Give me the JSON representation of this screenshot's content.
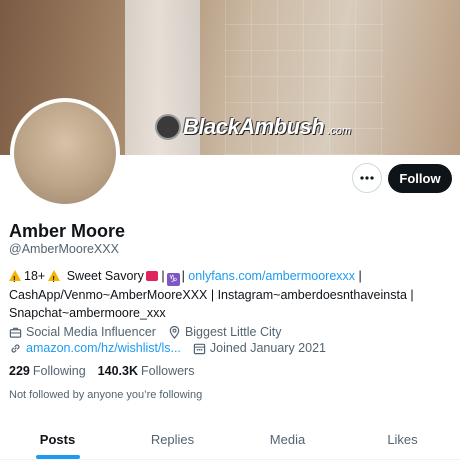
{
  "banner": {
    "logo_text": "BlackAmbush",
    "logo_tld": ".com"
  },
  "actions": {
    "follow_label": "Follow"
  },
  "profile": {
    "name": "Amber Moore",
    "handle": "@AmberMooreXXX",
    "bio": {
      "line1_a": "18+",
      "line1_b": "Sweet Savory",
      "line1_c": "|",
      "line1_sign": "♑",
      "line1_d": "|",
      "line1_link": "onlyfans.com/ambermoorexxx",
      "line1_e": "|",
      "line2": "CashApp/Venmo~AmberMooreXXX | Instagram~amberdoesnthaveinsta |",
      "line3": "Snapchat~ambermoore_xxx"
    },
    "category": "Social Media Influencer",
    "location": "Biggest Little City",
    "website": "amazon.com/hz/wishlist/ls...",
    "joined": "Joined January 2021",
    "following_count": "229",
    "following_label": "Following",
    "followers_count": "140.3K",
    "followers_label": "Followers",
    "not_followed": "Not followed by anyone you’re following"
  },
  "tabs": [
    {
      "label": "Posts"
    },
    {
      "label": "Replies"
    },
    {
      "label": "Media"
    },
    {
      "label": "Likes"
    }
  ],
  "colors": {
    "accent": "#1d9bf0",
    "text": "#0f1419",
    "muted": "#536471"
  }
}
